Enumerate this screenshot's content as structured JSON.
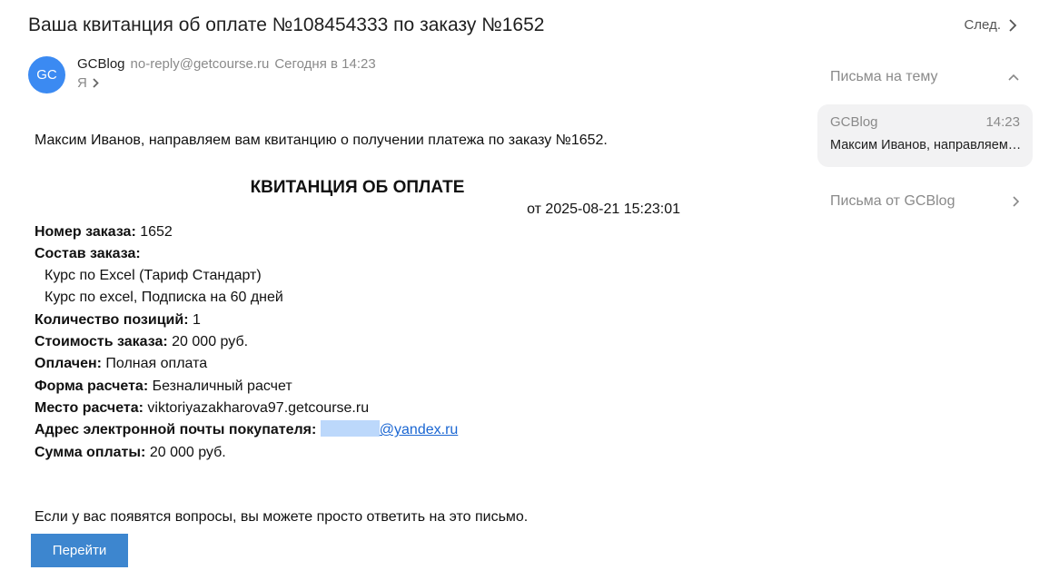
{
  "email": {
    "subject": "Ваша квитанция об оплате №108454333 по заказу №1652",
    "next_label": "След.",
    "sender": {
      "avatar_initials": "GC",
      "avatar_color": "#3b8af2",
      "name": "GCBlog",
      "email": "no-reply@getcourse.ru",
      "date": "Сегодня в 14:23",
      "recipient": "Я"
    },
    "body": {
      "intro": "Максим Иванов, направляем вам квитанцию о получении платежа по заказу №1652.",
      "receipt_title": "КВИТАНЦИЯ ОБ ОПЛАТЕ",
      "receipt_date": "от 2025-08-21 15:23:01",
      "order_number_label": "Номер заказа:",
      "order_number_value": "1652",
      "composition_label": "Состав заказа:",
      "items": [
        "Курс по Excel (Тариф Стандарт)",
        "Курс по excel, Подписка на 60 дней"
      ],
      "qty_label": "Количество позиций:",
      "qty_value": "1",
      "cost_label": "Стоимость заказа:",
      "cost_value": "20 000 руб.",
      "paid_label": "Оплачен:",
      "paid_value": "Полная оплата",
      "form_label": "Форма расчета:",
      "form_value": "Безналичный расчет",
      "place_label": "Место расчета:",
      "place_value": "viktoriyazakharova97.getcourse.ru",
      "buyer_email_label": "Адрес электронной почты покупателя:",
      "buyer_email_visible": "@yandex.ru",
      "sum_label": "Сумма оплаты:",
      "sum_value": "20 000 руб.",
      "footer": "Если у вас появятся вопросы, вы можете просто ответить на это письмо.",
      "button_label": "Перейти",
      "button_color": "#3d86cf"
    }
  },
  "sidebar": {
    "thread_header": "Письма на тему",
    "thread_item": {
      "from": "GCBlog",
      "time": "14:23",
      "snippet": "Максим Иванов, направляем вам квитанцию"
    },
    "from_sender_label": "Письма от GCBlog"
  }
}
